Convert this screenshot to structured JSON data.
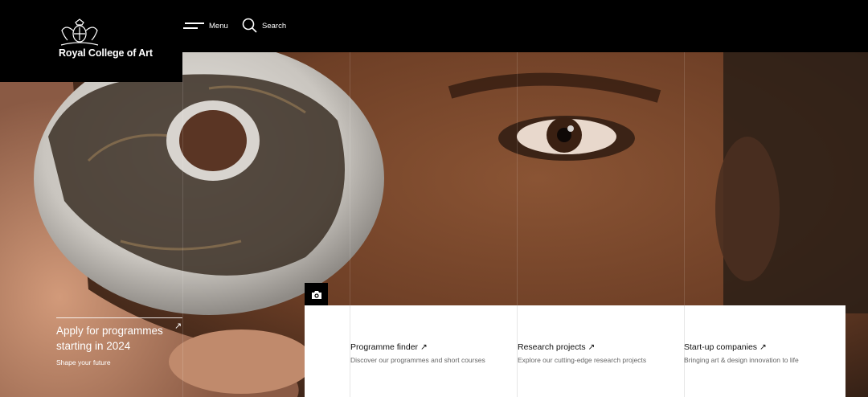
{
  "header": {
    "logo_text": "Royal College of Art",
    "menu_label": "Menu",
    "search_label": "Search"
  },
  "icons": {
    "crest": "royal-crest-icon",
    "menu": "hamburger-icon",
    "search": "search-icon",
    "camera": "camera-icon",
    "arrow": "arrow-up-right-icon"
  },
  "hero": {
    "apply_title": "Apply for programmes starting in 2024",
    "apply_arrow": "↗",
    "apply_sub": "Shape your future"
  },
  "links": [
    {
      "title": "Programme finder ↗",
      "description": "Discover our programmes and short courses"
    },
    {
      "title": "Research projects ↗",
      "description": "Explore our cutting-edge research projects"
    },
    {
      "title": "Start-up companies ↗",
      "description": "Bringing art & design innovation to life"
    }
  ]
}
